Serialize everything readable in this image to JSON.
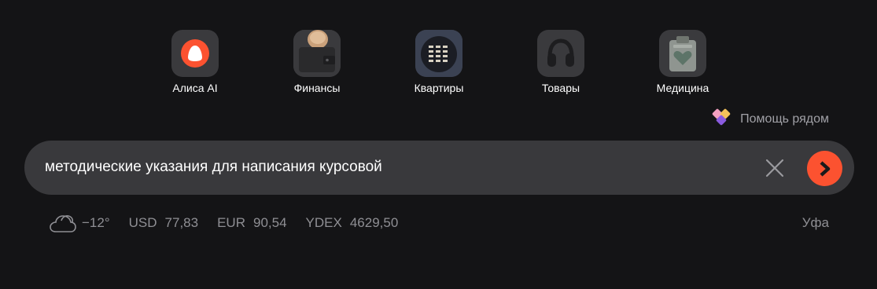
{
  "services": [
    {
      "label": "Алиса AI",
      "icon": "alice-ai-icon"
    },
    {
      "label": "Финансы",
      "icon": "finance-wallet-icon"
    },
    {
      "label": "Квартиры",
      "icon": "apartments-building-icon"
    },
    {
      "label": "Товары",
      "icon": "headphones-icon"
    },
    {
      "label": "Медицина",
      "icon": "medicine-clipboard-icon"
    }
  ],
  "help": {
    "label": "Помощь рядом",
    "icon": "help-hearts-icon"
  },
  "search": {
    "value": "методические указания для написания курсовой"
  },
  "weather": {
    "temperature": "−12°",
    "icon": "cloud-icon"
  },
  "rates": [
    {
      "name": "USD",
      "value": "77,83"
    },
    {
      "name": "EUR",
      "value": "90,54"
    },
    {
      "name": "YDEX",
      "value": "4629,50"
    }
  ],
  "city": "Уфа",
  "colors": {
    "background": "#141416",
    "searchbar": "#39393c",
    "accent": "#fc5230"
  }
}
